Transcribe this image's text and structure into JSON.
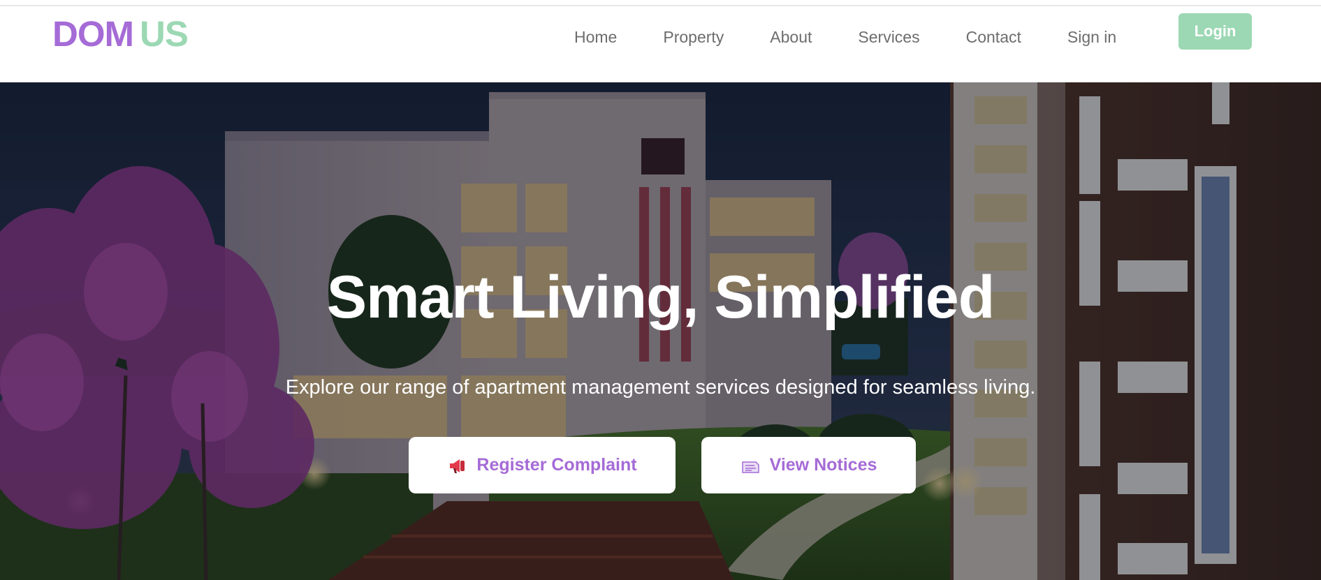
{
  "brand": {
    "part1": "DOM",
    "part2": "US",
    "color1": "#a56bd6",
    "color2": "#9bd8b3"
  },
  "nav": {
    "items": [
      {
        "label": "Home"
      },
      {
        "label": "Property"
      },
      {
        "label": "About"
      },
      {
        "label": "Services"
      },
      {
        "label": "Contact"
      },
      {
        "label": "Sign in"
      }
    ],
    "login_label": "Login",
    "login_color": "#9bd8b3",
    "text_color": "#6d6d6d"
  },
  "hero": {
    "title": "Smart Living, Simplified",
    "subtitle": "Explore our range of apartment management services designed for seamless living.",
    "buttons": [
      {
        "label": "Register Complaint",
        "icon": "megaphone-icon"
      },
      {
        "label": "View Notices",
        "icon": "notice-icon"
      }
    ],
    "button_text_color": "#a56bd6"
  }
}
